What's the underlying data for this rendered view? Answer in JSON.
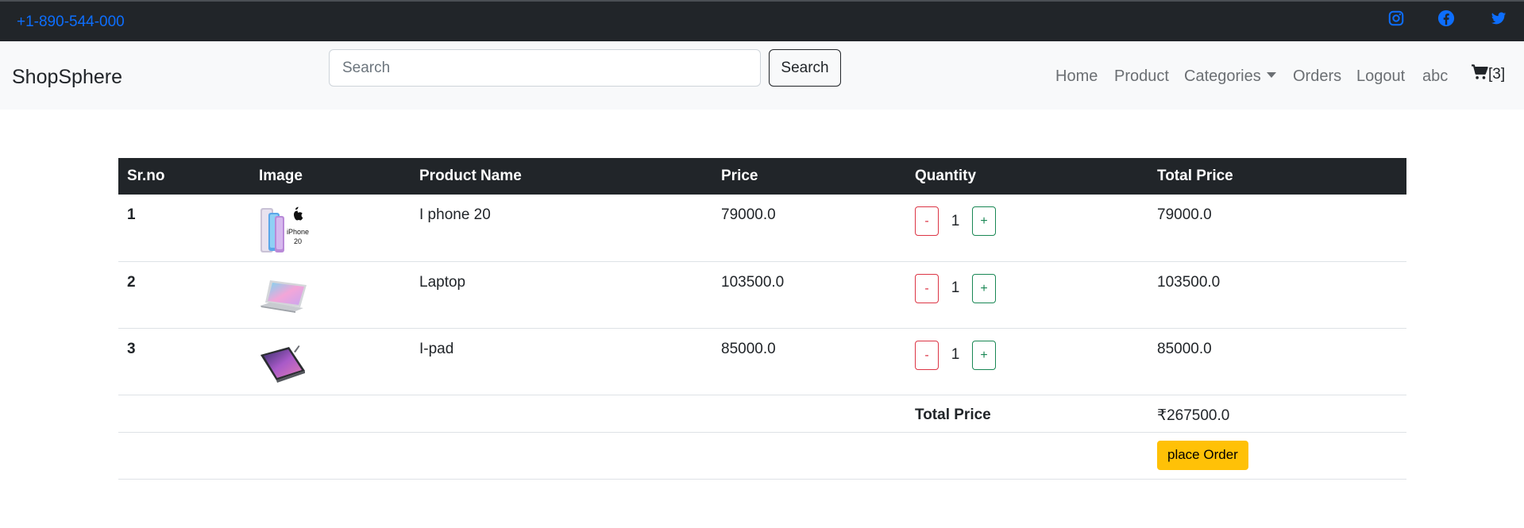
{
  "topbar": {
    "phone": "+1-890-544-000",
    "social": [
      {
        "icon": "instagram-icon"
      },
      {
        "icon": "facebook-icon"
      },
      {
        "icon": "twitter-icon"
      }
    ]
  },
  "navbar": {
    "brand": "ShopSphere",
    "search_placeholder": "Search",
    "search_button": "Search",
    "links": {
      "home": "Home",
      "product": "Product",
      "categories": "Categories",
      "orders": "Orders",
      "logout": "Logout",
      "user": "abc"
    },
    "cart_count": "[3]",
    "cart_icon": "cart-icon"
  },
  "cart_table": {
    "headers": [
      "Sr.no",
      "Image",
      "Product Name",
      "Price",
      "Quantity",
      "Total Price"
    ],
    "rows": [
      {
        "sr": "1",
        "image": "iphone-image",
        "name": "I phone 20",
        "price": "79000.0",
        "minus": "-",
        "qty": "1",
        "plus": "+",
        "total": "79000.0"
      },
      {
        "sr": "2",
        "image": "laptop-image",
        "name": "Laptop",
        "price": "103500.0",
        "minus": "-",
        "qty": "1",
        "plus": "+",
        "total": "103500.0"
      },
      {
        "sr": "3",
        "image": "ipad-image",
        "name": "I-pad",
        "price": "85000.0",
        "minus": "-",
        "qty": "1",
        "plus": "+",
        "total": "85000.0"
      }
    ],
    "total_label": "Total Price",
    "total_value": "₹267500.0",
    "place_order": "place Order"
  },
  "colors": {
    "topbar_bg": "#212529",
    "link_blue": "#0d6efd",
    "navbar_bg": "#f8f9fa",
    "minus_red": "#dc3545",
    "plus_green": "#198754",
    "order_yellow": "#ffc107"
  }
}
